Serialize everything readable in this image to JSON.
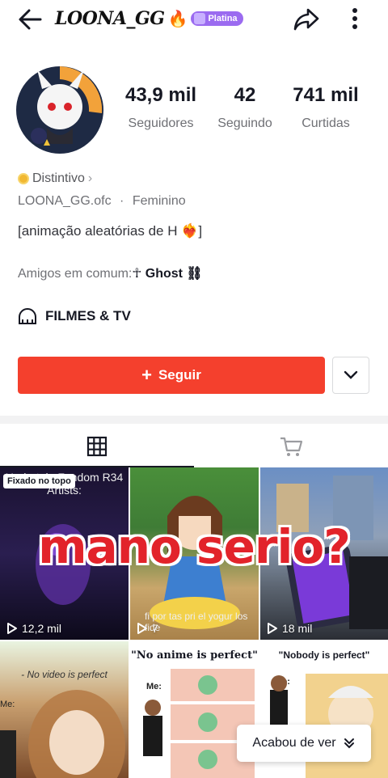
{
  "header": {
    "username": "LOONA_GG",
    "title_emoji": "🔥",
    "badge_label": "Platina",
    "badge_color": "#9b6bf0",
    "back_icon": "arrow-left-icon",
    "share_icon": "share-arrow-icon",
    "more_icon": "vertical-dots-icon"
  },
  "stats": [
    {
      "value": "43,9 mil",
      "label": "Seguidores"
    },
    {
      "value": "42",
      "label": "Seguindo"
    },
    {
      "value": "741 mil",
      "label": "Curtidas"
    }
  ],
  "profile": {
    "distintivo": "Distintivo",
    "handle": "LOONA_GG.ofc",
    "separator": "·",
    "gender": "Feminino",
    "bio": "[animação aleatórias de H ❤️‍🔥]",
    "friends_label": "Amigos em comum:",
    "friends_name": "☥ Ghost ⛓",
    "category": "FILMES & TV"
  },
  "actions": {
    "follow_label": "Seguir",
    "follow_color": "#f4402d"
  },
  "tabs": [
    {
      "icon": "grid-icon",
      "active": true
    },
    {
      "icon": "shopping-cart-icon",
      "active": false
    }
  ],
  "videos": [
    {
      "views": "12,2 mil",
      "pinned_label": "Fixado no topo",
      "caption": "Undertale Fandom R34 Artists:"
    },
    {
      "views": "7",
      "caption": "fi por tas pri el yogur los fide"
    },
    {
      "views": "18 mil"
    },
    {
      "caption": "- No video is perfect",
      "side_text": "Me:"
    },
    {
      "caption": "\"No anime is perfect\"",
      "side_text": "Me:"
    },
    {
      "caption": "\"Nobody is perfect\"",
      "side_text": "Me:"
    }
  ],
  "overlay_caption": "mano serio?",
  "end_notice": "Acabou de ver"
}
